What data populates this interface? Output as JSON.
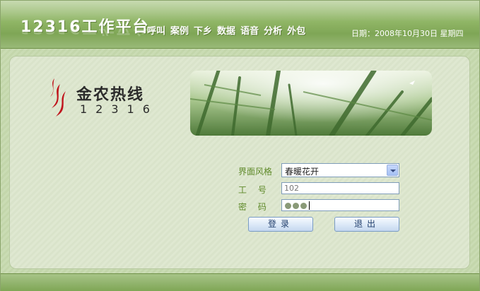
{
  "header": {
    "brand": "12316工作平台",
    "nav": [
      "呼叫",
      "案例",
      "下乡",
      "数据",
      "语音",
      "分析",
      "外包"
    ],
    "date": "日期：2008年10月30日  星期四"
  },
  "logo": {
    "title": "金农热线",
    "digits": "12316"
  },
  "form": {
    "style_label": "界面风格",
    "style_value": "春暖花开",
    "id_label": "工　 号",
    "id_value": "102",
    "password_label": "密　 码",
    "password_length": 3
  },
  "buttons": {
    "login": "登录",
    "exit": "退出"
  },
  "colors": {
    "header_green": "#8fb565",
    "label_green": "#5f8a2a",
    "logo_red": "#c0141c"
  }
}
